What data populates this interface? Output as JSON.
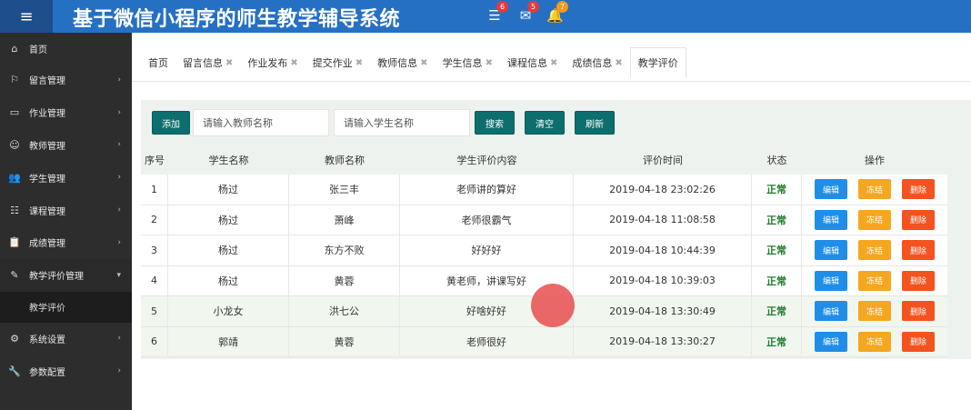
{
  "header": {
    "title": "基于微信小程序的师生教学辅导系统",
    "menu_icon": "hamburger-icon",
    "icons": [
      {
        "name": "tasks-icon",
        "glyph": "☰",
        "badge": "6",
        "badge_color": "#e23b3b"
      },
      {
        "name": "mail-icon",
        "glyph": "✉",
        "badge": "5",
        "badge_color": "#e23b3b"
      },
      {
        "name": "bell-icon",
        "glyph": "🔔",
        "badge": "7",
        "badge_color": "#f29b1a"
      }
    ]
  },
  "sidebar": {
    "items": [
      {
        "label": "首页",
        "icon": "home-icon",
        "glyph": "⌂",
        "has_children": false
      },
      {
        "label": "留言管理",
        "icon": "flag-icon",
        "glyph": "⚐",
        "has_children": true
      },
      {
        "label": "作业管理",
        "icon": "window-icon",
        "glyph": "▭",
        "has_children": true
      },
      {
        "label": "教师管理",
        "icon": "user-icon",
        "glyph": "☺",
        "has_children": true
      },
      {
        "label": "学生管理",
        "icon": "users-icon",
        "glyph": "👥",
        "has_children": true
      },
      {
        "label": "课程管理",
        "icon": "list-icon",
        "glyph": "☷",
        "has_children": true
      },
      {
        "label": "成绩管理",
        "icon": "clipboard-icon",
        "glyph": "📋",
        "has_children": true
      },
      {
        "label": "教学评价管理",
        "icon": "edit-icon",
        "glyph": "✎",
        "has_children": true,
        "open": true
      },
      {
        "label": "系统设置",
        "icon": "gear-icon",
        "glyph": "⚙",
        "has_children": true
      },
      {
        "label": "参数配置",
        "icon": "wrench-icon",
        "glyph": "🔧",
        "has_children": true
      }
    ],
    "subitem": "教学评价"
  },
  "tabs": [
    {
      "label": "首页",
      "closable": false
    },
    {
      "label": "留言信息",
      "closable": true
    },
    {
      "label": "作业发布",
      "closable": true
    },
    {
      "label": "提交作业",
      "closable": true
    },
    {
      "label": "教师信息",
      "closable": true
    },
    {
      "label": "学生信息",
      "closable": true
    },
    {
      "label": "课程信息",
      "closable": true
    },
    {
      "label": "成绩信息",
      "closable": true
    },
    {
      "label": "教学评价",
      "closable": false,
      "active": true
    }
  ],
  "toolbar": {
    "add_label": "添加",
    "teacher_placeholder": "请输入教师名称",
    "student_placeholder": "请输入学生名称",
    "search_label": "搜索",
    "clear_label": "清空",
    "refresh_label": "刷新"
  },
  "table": {
    "columns": [
      "序号",
      "学生名称",
      "教师名称",
      "学生评价内容",
      "评价时间",
      "状态",
      "操作"
    ],
    "rows": [
      {
        "no": "1",
        "student": "杨过",
        "teacher": "张三丰",
        "content": "老师讲的算好",
        "time": "2019-04-18 23:02:26",
        "status": "正常"
      },
      {
        "no": "2",
        "student": "杨过",
        "teacher": "萧峰",
        "content": "老师很霸气",
        "time": "2019-04-18 11:08:58",
        "status": "正常"
      },
      {
        "no": "3",
        "student": "杨过",
        "teacher": "东方不败",
        "content": "好好好",
        "time": "2019-04-18 10:44:39",
        "status": "正常"
      },
      {
        "no": "4",
        "student": "杨过",
        "teacher": "黄蓉",
        "content": "黄老师，讲课写好",
        "time": "2019-04-18 10:39:03",
        "status": "正常"
      },
      {
        "no": "5",
        "student": "小龙女",
        "teacher": "洪七公",
        "content": "好啥好好",
        "time": "2019-04-18 13:30:49",
        "status": "正常"
      },
      {
        "no": "6",
        "student": "郭靖",
        "teacher": "黄蓉",
        "content": "老师很好",
        "time": "2019-04-18 13:30:27",
        "status": "正常"
      }
    ],
    "actions": {
      "edit": "编辑",
      "freeze": "冻结",
      "delete": "删除"
    }
  },
  "colors": {
    "header_bg": "#2670c4",
    "sidebar_bg": "#2d2d2d",
    "teal_button": "#0d6e6e",
    "edit_button": "#1e8ee8",
    "freeze_button": "#f5a71f",
    "delete_button": "#f4521e",
    "status_text": "#1e7c2c"
  }
}
